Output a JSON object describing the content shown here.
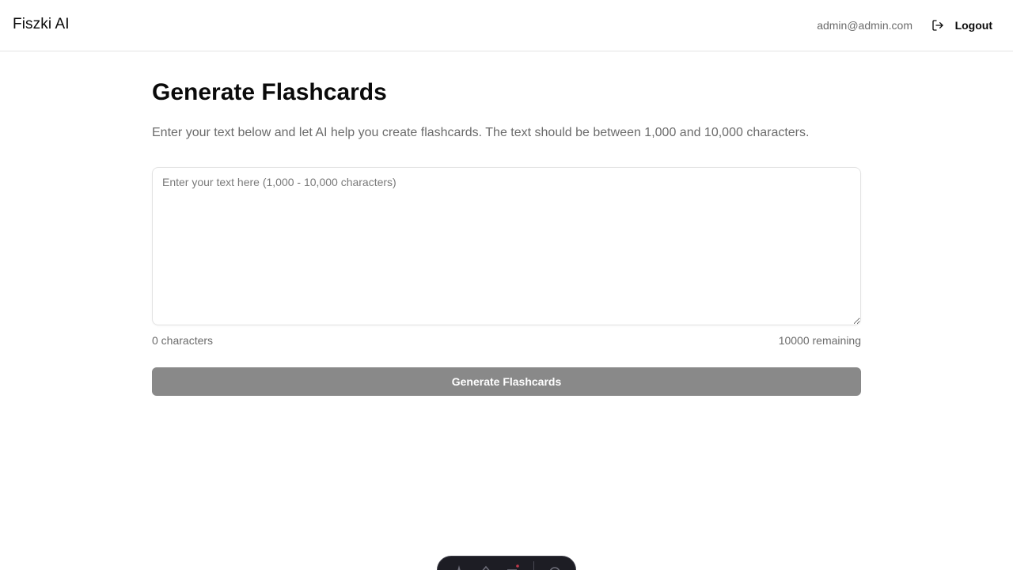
{
  "header": {
    "brand": "Fiszki AI",
    "user_email": "admin@admin.com",
    "logout_label": "Logout"
  },
  "main": {
    "title": "Generate Flashcards",
    "description": "Enter your text below and let AI help you create flashcards. The text should be between 1,000 and 10,000 characters.",
    "textarea": {
      "placeholder": "Enter your text here (1,000 - 10,000 characters)",
      "value": ""
    },
    "char_count": "0 characters",
    "remaining": "10000 remaining",
    "generate_button": "Generate Flashcards"
  },
  "dev_toolbar": {
    "icons": [
      "astro-logo-icon",
      "inspect-icon",
      "audit-icon",
      "settings-icon"
    ]
  },
  "colors": {
    "button_disabled": "#898989",
    "muted_text": "#6b6b6b",
    "border": "#e5e5e5"
  }
}
